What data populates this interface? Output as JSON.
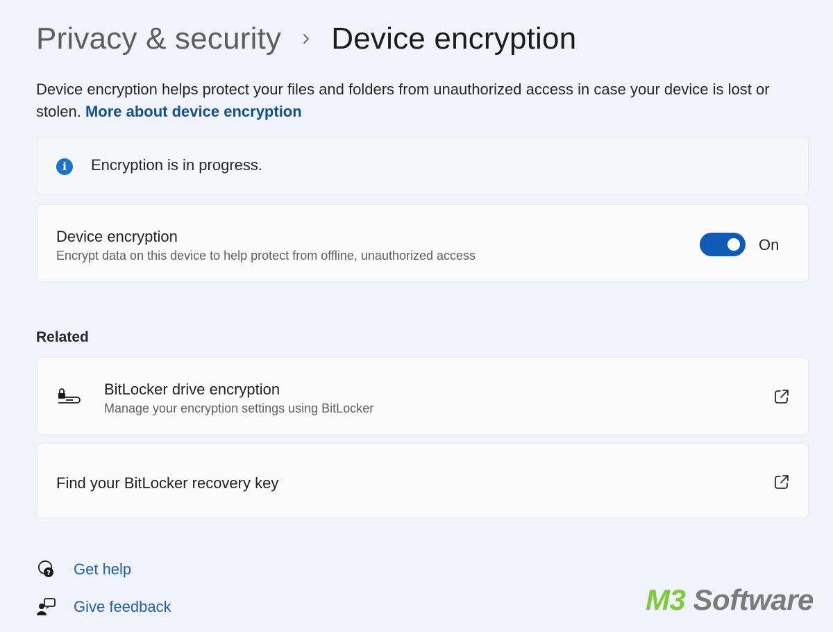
{
  "breadcrumb": {
    "parent": "Privacy & security",
    "separator_icon": "chevron-right-icon",
    "current": "Device encryption"
  },
  "description": {
    "text": "Device encryption helps protect your files and folders from unauthorized access in case your device is lost or stolen.",
    "link": "More about device encryption"
  },
  "info_bar": {
    "icon": "info-icon",
    "text": "Encryption is in progress."
  },
  "device_encryption": {
    "title": "Device encryption",
    "subtitle": "Encrypt data on this device to help protect from offline, unauthorized access",
    "toggle_state": true,
    "toggle_label": "On"
  },
  "related": {
    "heading": "Related",
    "items": [
      {
        "icon": "bitlocker-drive-icon",
        "title": "BitLocker drive encryption",
        "subtitle": "Manage your encryption settings using BitLocker",
        "action_icon": "open-external-icon"
      },
      {
        "title": "Find your BitLocker recovery key",
        "action_icon": "open-external-icon"
      }
    ]
  },
  "footer": {
    "help": {
      "icon": "help-chat-icon",
      "label": "Get help"
    },
    "feedback": {
      "icon": "feedback-person-icon",
      "label": "Give feedback"
    }
  },
  "watermark": {
    "part1": "M3",
    "part2": " Software"
  },
  "colors": {
    "background": "#f0f3f9",
    "accent": "#0f5bb5",
    "link": "#134f8c",
    "info_icon": "#1a72c9",
    "watermark_green": "#7fc83f",
    "watermark_gray": "#7b7b7b"
  }
}
